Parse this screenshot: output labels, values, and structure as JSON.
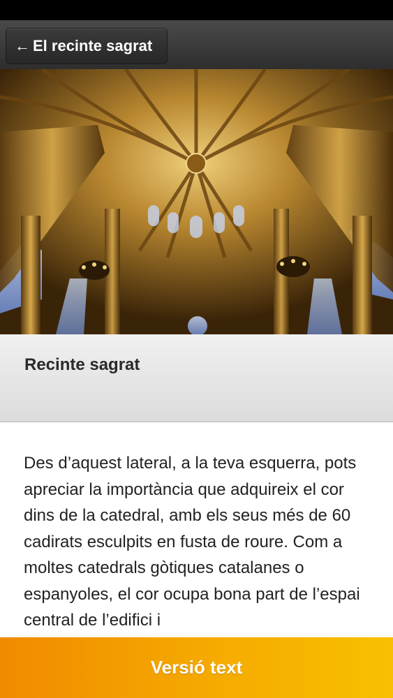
{
  "nav": {
    "back_label": "El recinte sagrat"
  },
  "hero": {
    "image_alt": "Cathedral vaulted apse with stained glass windows"
  },
  "section": {
    "title": "Recinte sagrat",
    "body": "Des d’aquest lateral, a la teva esquerra, pots apreciar la importància que adquireix el cor dins de la catedral, amb els seus més de 60 cadirats esculpits en fusta de roure. Com a moltes catedrals gòtiques catalanes o espanyoles, el cor ocupa bona part de l’espai central de l’edifici i"
  },
  "footer": {
    "button_label": "Versió text"
  },
  "colors": {
    "accent_start": "#f08a00",
    "accent_end": "#f8c000",
    "nav_bg": "#3a3a3a"
  }
}
